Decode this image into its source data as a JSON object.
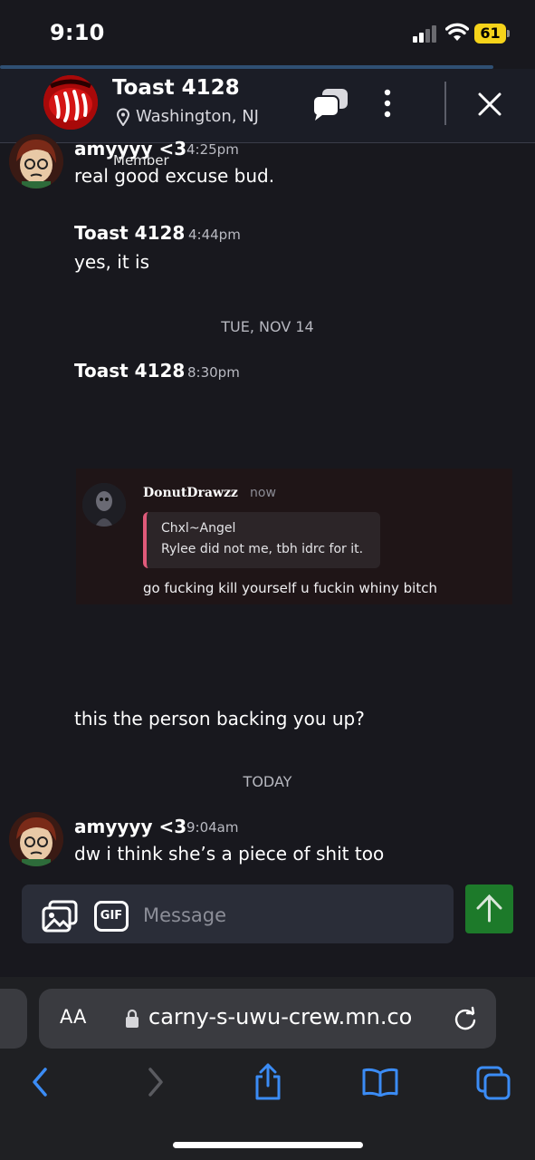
{
  "status_bar": {
    "time": "9:10",
    "battery": "61"
  },
  "header": {
    "title": "Toast 4128",
    "location": "Washington, NJ",
    "icons": {
      "chat": "chat-bubbles-icon",
      "more": "more-vertical-icon",
      "close": "close-icon",
      "pin": "location-pin-icon"
    }
  },
  "messages": [
    {
      "sender": "amyyyy <3",
      "time": "4:25pm",
      "tag": "Member",
      "text": "real good excuse bud."
    },
    {
      "sender": "Toast 4128",
      "time": "4:44pm",
      "text": "yes, it is"
    }
  ],
  "date_separator_1": "TUE, NOV 14",
  "message_3": {
    "sender": "Toast 4128",
    "time": "8:30pm"
  },
  "embed": {
    "name": "DonutDrawzz",
    "time": "now",
    "quote_author": "Chxl~Angel",
    "quote_text": "Rylee did not me, tbh idrc for it.",
    "reply": "go fucking kill yourself u fuckin whiny bitch"
  },
  "message_3_text": "this the person backing you up?",
  "date_separator_2": "TODAY",
  "message_4": {
    "sender": "amyyyy <3",
    "time": "9:04am",
    "text": "dw i think she’s a piece of shit too"
  },
  "composer": {
    "gif_label": "GIF",
    "placeholder": "Message"
  },
  "safari": {
    "aa": "AA",
    "url": "carny-s-uwu-crew.mn.co"
  },
  "colors": {
    "send_button": "#1d7a2a",
    "quote_accent": "#e05a7a",
    "background": "#18181e"
  }
}
